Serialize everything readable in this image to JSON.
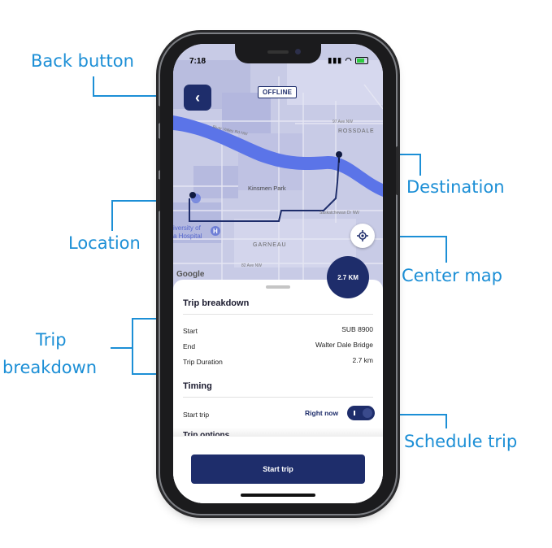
{
  "callouts": {
    "back_button": "Back button",
    "location": "Location",
    "trip": "Trip",
    "breakdown": "breakdown",
    "destination": "Destination",
    "center_map": "Center map",
    "schedule_trip": "Schedule trip"
  },
  "status_bar": {
    "time": "7:18",
    "icons": "signal wifi battery"
  },
  "map": {
    "offline_badge": "OFFLINE",
    "labels": {
      "rossdale": "ROSSDALE",
      "kinsmen_park": "Kinsmen Park",
      "garneau": "GARNEAU",
      "university_hospital_1": "iversity of",
      "university_hospital_2": "a Hospital",
      "ave_97": "97 Ave NW",
      "ave_82": "82 Ave NW",
      "river_valley": "River Valley Rd NW",
      "saskatchewan": "Saskatchewan Dr NW"
    },
    "attribution": "Google",
    "distance_badge": "2.7 KM"
  },
  "trip_breakdown": {
    "title": "Trip breakdown",
    "rows": [
      {
        "label": "Start",
        "value": "SUB 8900"
      },
      {
        "label": "End",
        "value": "Walter Dale Bridge"
      },
      {
        "label": "Trip Duration",
        "value": "2.7 km"
      }
    ]
  },
  "timing": {
    "title": "Timing",
    "start_label": "Start trip",
    "start_value": "Right now"
  },
  "trip_options_peek": "Trip options",
  "start_button": "Start trip",
  "colors": {
    "brand_navy": "#1e2d6b",
    "callout_blue": "#1c8fd6",
    "river": "#5b74e8"
  }
}
